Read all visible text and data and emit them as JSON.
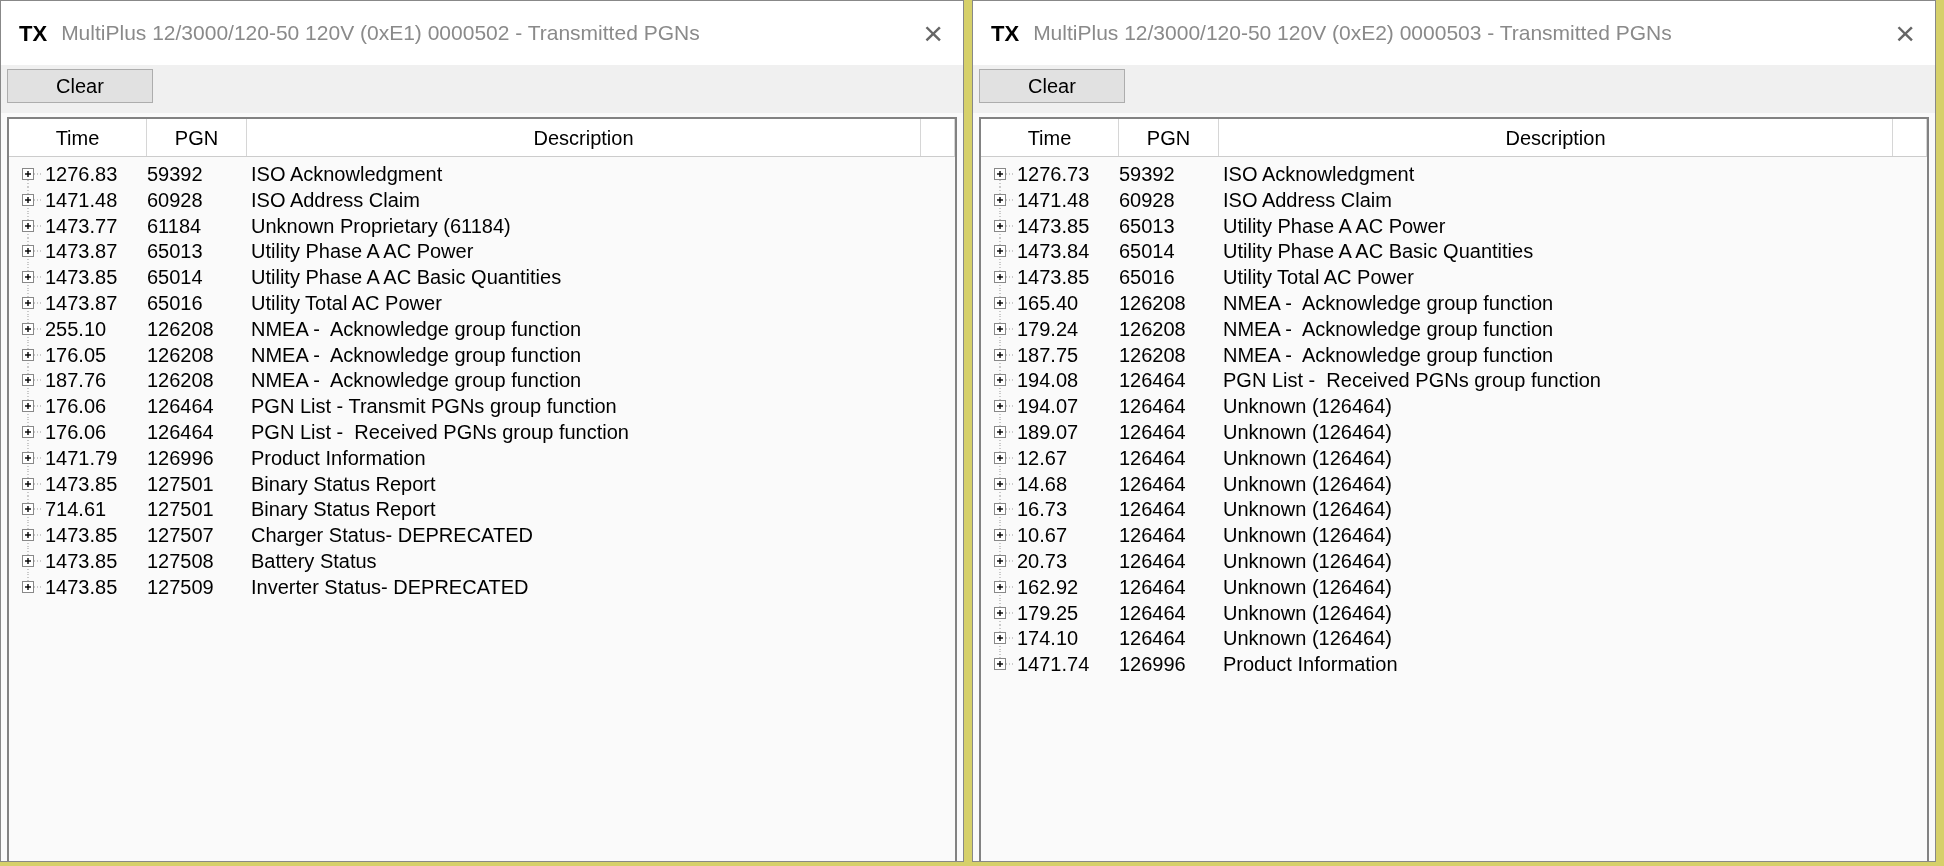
{
  "windows": [
    {
      "tag": "TX",
      "title": "MultiPlus 12/3000/120-50 120V (0xE1) 0000502 - Transmitted PGNs",
      "close": "×",
      "clear_button": "Clear",
      "columns": [
        "Time",
        "PGN",
        "Description"
      ],
      "rows": [
        {
          "time": "1276.83",
          "pgn": "59392",
          "description": "ISO Acknowledgment",
          "expanded": false
        },
        {
          "time": "1471.48",
          "pgn": "60928",
          "description": "ISO Address Claim",
          "expanded": false
        },
        {
          "time": "1473.77",
          "pgn": "61184",
          "description": "Unknown Proprietary (61184)",
          "expanded": false
        },
        {
          "time": "1473.87",
          "pgn": "65013",
          "description": "Utility Phase A AC Power",
          "expanded": false
        },
        {
          "time": "1473.85",
          "pgn": "65014",
          "description": "Utility Phase A AC Basic Quantities",
          "expanded": false
        },
        {
          "time": "1473.87",
          "pgn": "65016",
          "description": "Utility Total AC Power",
          "expanded": false
        },
        {
          "time": "255.10",
          "pgn": "126208",
          "description": "NMEA -  Acknowledge group function",
          "expanded": false
        },
        {
          "time": "176.05",
          "pgn": "126208",
          "description": "NMEA -  Acknowledge group function",
          "expanded": false
        },
        {
          "time": "187.76",
          "pgn": "126208",
          "description": "NMEA -  Acknowledge group function",
          "expanded": false
        },
        {
          "time": "176.06",
          "pgn": "126464",
          "description": "PGN List - Transmit PGNs group function",
          "expanded": false
        },
        {
          "time": "176.06",
          "pgn": "126464",
          "description": "PGN List -  Received PGNs group function",
          "expanded": false
        },
        {
          "time": "1471.79",
          "pgn": "126996",
          "description": "Product Information",
          "expanded": false
        },
        {
          "time": "1473.85",
          "pgn": "127501",
          "description": "Binary Status Report",
          "expanded": false
        },
        {
          "time": "714.61",
          "pgn": "127501",
          "description": "Binary Status Report",
          "expanded": false
        },
        {
          "time": "1473.85",
          "pgn": "127507",
          "description": "Charger Status- DEPRECATED",
          "expanded": false
        },
        {
          "time": "1473.85",
          "pgn": "127508",
          "description": "Battery Status",
          "expanded": false
        },
        {
          "time": "1473.85",
          "pgn": "127509",
          "description": "Inverter Status- DEPRECATED",
          "expanded": false
        }
      ]
    },
    {
      "tag": "TX",
      "title": "MultiPlus 12/3000/120-50 120V (0xE2) 0000503 - Transmitted PGNs",
      "close": "×",
      "clear_button": "Clear",
      "columns": [
        "Time",
        "PGN",
        "Description"
      ],
      "rows": [
        {
          "time": "1276.73",
          "pgn": "59392",
          "description": "ISO Acknowledgment",
          "expanded": false
        },
        {
          "time": "1471.48",
          "pgn": "60928",
          "description": "ISO Address Claim",
          "expanded": false
        },
        {
          "time": "1473.85",
          "pgn": "65013",
          "description": "Utility Phase A AC Power",
          "expanded": false
        },
        {
          "time": "1473.84",
          "pgn": "65014",
          "description": "Utility Phase A AC Basic Quantities",
          "expanded": false
        },
        {
          "time": "1473.85",
          "pgn": "65016",
          "description": "Utility Total AC Power",
          "expanded": false
        },
        {
          "time": "165.40",
          "pgn": "126208",
          "description": "NMEA -  Acknowledge group function",
          "expanded": false
        },
        {
          "time": "179.24",
          "pgn": "126208",
          "description": "NMEA -  Acknowledge group function",
          "expanded": false
        },
        {
          "time": "187.75",
          "pgn": "126208",
          "description": "NMEA -  Acknowledge group function",
          "expanded": false
        },
        {
          "time": "194.08",
          "pgn": "126464",
          "description": "PGN List -  Received PGNs group function",
          "expanded": false
        },
        {
          "time": "194.07",
          "pgn": "126464",
          "description": "Unknown (126464)",
          "expanded": false
        },
        {
          "time": "189.07",
          "pgn": "126464",
          "description": "Unknown (126464)",
          "expanded": false
        },
        {
          "time": "12.67",
          "pgn": "126464",
          "description": "Unknown (126464)",
          "expanded": false
        },
        {
          "time": "14.68",
          "pgn": "126464",
          "description": "Unknown (126464)",
          "expanded": false
        },
        {
          "time": "16.73",
          "pgn": "126464",
          "description": "Unknown (126464)",
          "expanded": false
        },
        {
          "time": "10.67",
          "pgn": "126464",
          "description": "Unknown (126464)",
          "expanded": false
        },
        {
          "time": "20.73",
          "pgn": "126464",
          "description": "Unknown (126464)",
          "expanded": false
        },
        {
          "time": "162.92",
          "pgn": "126464",
          "description": "Unknown (126464)",
          "expanded": false
        },
        {
          "time": "179.25",
          "pgn": "126464",
          "description": "Unknown (126464)",
          "expanded": false
        },
        {
          "time": "174.10",
          "pgn": "126464",
          "description": "Unknown (126464)",
          "expanded": false
        },
        {
          "time": "1471.74",
          "pgn": "126996",
          "description": "Product Information",
          "expanded": false
        }
      ]
    }
  ]
}
